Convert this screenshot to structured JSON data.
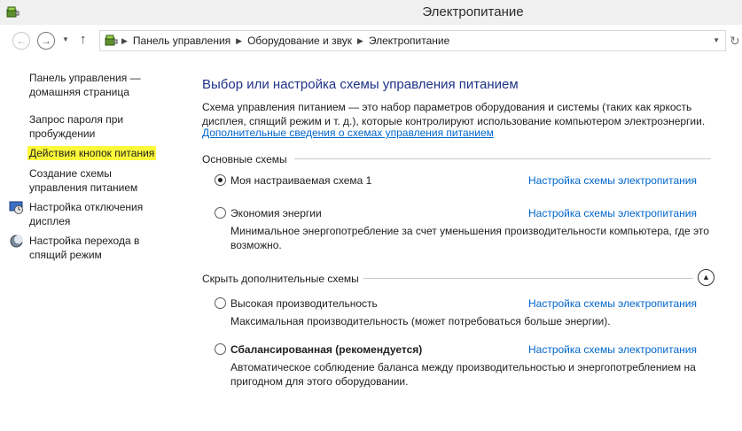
{
  "window": {
    "title": "Электропитание",
    "app_icon": "power-options-icon"
  },
  "nav": {
    "back_icon": "back-arrow-icon",
    "forward_icon": "forward-arrow-icon",
    "recent_icon": "chevron-down-icon",
    "up_icon": "up-arrow-icon",
    "refresh_icon": "refresh-icon"
  },
  "address": {
    "crumbs": [
      {
        "label": "Панель управления"
      },
      {
        "label": "Оборудование и звук"
      },
      {
        "label": "Электропитание"
      }
    ]
  },
  "sidebar": {
    "items": [
      {
        "label": "Панель управления — домашняя страница"
      },
      {
        "label": "Запрос пароля при пробуждении"
      },
      {
        "label": "Действия кнопок питания",
        "highlight_color": "#fcf83a"
      },
      {
        "label": "Создание схемы управления питанием"
      },
      {
        "label": "Настройка отключения дисплея",
        "icon": "display-icon"
      },
      {
        "label": "Настройка перехода в спящий режим",
        "icon": "moon-icon"
      }
    ]
  },
  "main": {
    "title": "Выбор или настройка схемы управления питанием",
    "description": "Схема управления питанием — это набор параметров оборудования и системы (таких как яркость дисплея, спящий режим и т. д.), которые контролируют использование компьютером электроэнергии.",
    "more_link": "Дополнительные сведения о схемах управления питанием",
    "basic_section": "Основные схемы",
    "hidden_section": "Скрыть дополнительные схемы",
    "collapse_icon": "chevron-up-icon",
    "plans": [
      {
        "name": "Моя настраиваемая схема 1",
        "settings": "Настройка схемы электропитания",
        "selected": true,
        "description": ""
      },
      {
        "name": "Экономия энергии",
        "settings": "Настройка схемы электропитания",
        "selected": false,
        "description": "Минимальное энергопотребление за счет уменьшения производительности компьютера, где это возможно."
      },
      {
        "name": "Высокая производительность",
        "settings": "Настройка схемы электропитания",
        "selected": false,
        "description": "Максимальная производительность (может потребоваться больше энергии)."
      },
      {
        "name": "Сбалансированная (рекомендуется)",
        "settings": "Настройка схемы электропитания",
        "selected": false,
        "bold": true,
        "description": "Автоматическое соблюдение баланса между производительностью и энергопотреблением на пригодном для этого оборудовании."
      }
    ]
  },
  "colors": {
    "link": "#0066cc",
    "title": "#1e3287",
    "highlight": "#fcf83a"
  }
}
